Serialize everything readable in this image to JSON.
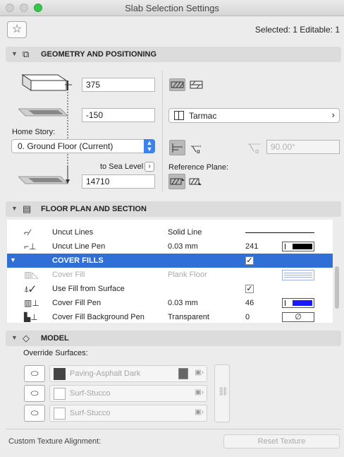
{
  "window": {
    "title": "Slab Selection Settings"
  },
  "header": {
    "selection_info": "Selected: 1 Editable: 1"
  },
  "sections": {
    "geometry": {
      "title": "GEOMETRY AND POSITIONING"
    },
    "floor_plan": {
      "title": "FLOOR PLAN AND SECTION"
    },
    "model": {
      "title": "MODEL"
    }
  },
  "geometry": {
    "thickness": "375",
    "offset": "-150",
    "home_story_label": "Home Story:",
    "home_story_value": "0. Ground Floor (Current)",
    "to_sea_level_label": "to Sea Level",
    "sea_level_value": "14710",
    "material": "Tarmac",
    "angle_value": "90.00°",
    "reference_plane_label": "Reference Plane:"
  },
  "floor_plan_rows": [
    {
      "name": "Uncut Lines",
      "value": "Solid Line",
      "num": "",
      "kind": "line"
    },
    {
      "name": "Uncut Line Pen",
      "value": "0.03 mm",
      "num": "241",
      "kind": "pen-black"
    },
    {
      "name": "COVER FILLS",
      "value": "",
      "num": "",
      "kind": "header"
    },
    {
      "name": "Cover Fill",
      "value": "Plank Floor",
      "num": "",
      "kind": "fill"
    },
    {
      "name": "Use Fill from Surface",
      "value": "",
      "num": "",
      "kind": "check"
    },
    {
      "name": "Cover Fill Pen",
      "value": "0.03 mm",
      "num": "46",
      "kind": "pen-blue"
    },
    {
      "name": "Cover Fill Background Pen",
      "value": "Transparent",
      "num": "0",
      "kind": "empty"
    }
  ],
  "model": {
    "override_label": "Override Surfaces:",
    "surfaces": [
      "Paving-Asphalt Dark",
      "Surf-Stucco",
      "Surf-Stucco"
    ]
  },
  "footer": {
    "custom_texture_label": "Custom Texture Alignment:",
    "reset_texture": "Reset Texture"
  },
  "colors": {
    "selection": "#2f6fd6",
    "pen_blue": "#1a1aff",
    "stepper": "#3b82f0"
  }
}
